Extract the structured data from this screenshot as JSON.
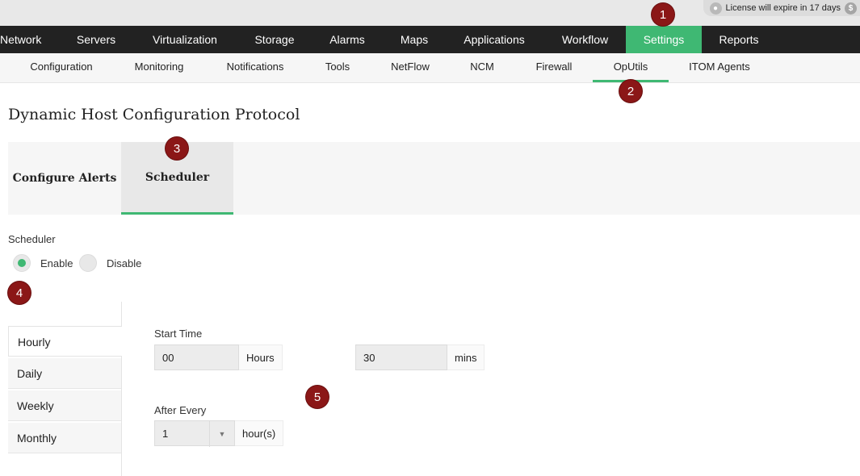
{
  "license": {
    "text": "License will expire in 17 days",
    "lock_icon": "badge-icon",
    "coin_icon": "dollar-icon"
  },
  "main_nav": {
    "items": [
      "Network",
      "Servers",
      "Virtualization",
      "Storage",
      "Alarms",
      "Maps",
      "Applications",
      "Workflow",
      "Settings",
      "Reports"
    ],
    "active": "Settings"
  },
  "sub_nav": {
    "items": [
      "Configuration",
      "Monitoring",
      "Notifications",
      "Tools",
      "NetFlow",
      "NCM",
      "Firewall",
      "OpUtils",
      "ITOM Agents"
    ],
    "active": "OpUtils"
  },
  "page_title": "Dynamic Host Configuration Protocol",
  "tabs": {
    "items": [
      "Configure Alerts",
      "Scheduler"
    ],
    "active": "Scheduler"
  },
  "scheduler": {
    "label": "Scheduler",
    "enable_label": "Enable",
    "disable_label": "Disable",
    "selected": "Enable"
  },
  "frequency": {
    "items": [
      "Hourly",
      "Daily",
      "Weekly",
      "Monthly"
    ],
    "active": "Hourly"
  },
  "start_time": {
    "label": "Start Time",
    "hours_value": "00",
    "hours_unit": "Hours",
    "mins_value": "30",
    "mins_unit": "mins"
  },
  "after_every": {
    "label": "After Every",
    "value": "1",
    "unit": "hour(s)",
    "arrow_icon": "caret-down-icon"
  },
  "callouts": [
    "1",
    "2",
    "3",
    "4",
    "5"
  ],
  "colors": {
    "accent": "#3fb873",
    "nav_bg": "#222222",
    "callout": "#8b1717"
  }
}
